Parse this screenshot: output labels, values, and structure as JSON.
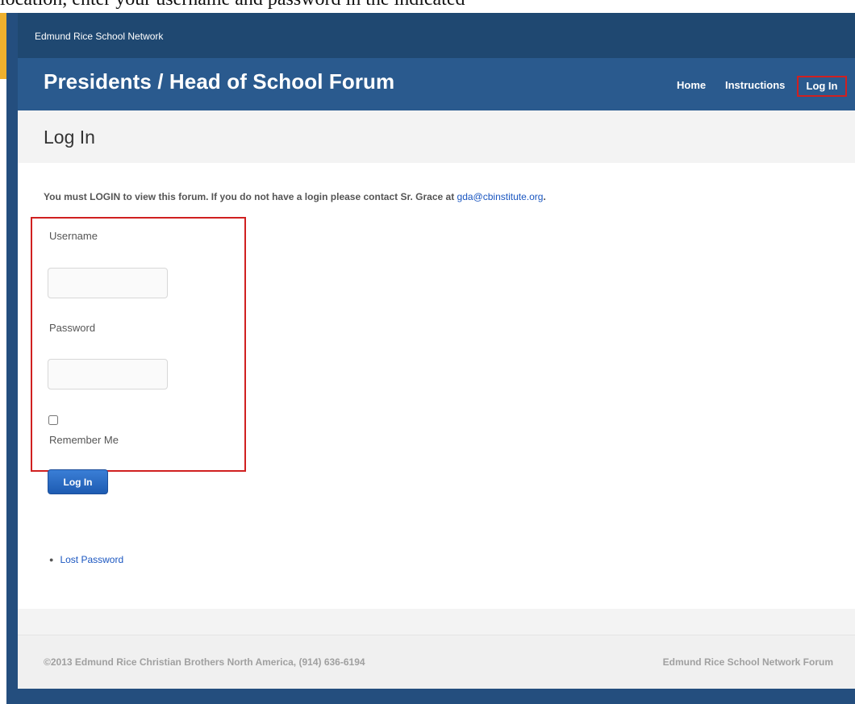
{
  "caption": "location, enter your username and password in the indicated",
  "network": {
    "label": "Edmund Rice School Network"
  },
  "header": {
    "title": "Presidents / Head of School Forum",
    "nav": {
      "home": "Home",
      "instructions": "Instructions",
      "login": "Log In"
    }
  },
  "page": {
    "title": "Log In"
  },
  "notice": {
    "text": "You must LOGIN to view this forum. If you do not have a login please contact Sr. Grace at ",
    "email": "gda@cbinstitute.org",
    "trailing": "."
  },
  "form": {
    "username_label": "Username",
    "username_value": "",
    "password_label": "Password",
    "password_value": "",
    "remember_label": "Remember Me",
    "remember_checked": false,
    "submit_label": "Log In"
  },
  "links": [
    {
      "label": "Lost Password"
    }
  ],
  "footer": {
    "copyright": "©2013 Edmund Rice Christian Brothers North America, (914) 636-6194",
    "site_name": "Edmund Rice School Network Forum"
  },
  "colors": {
    "header_blue": "#2a5a8e",
    "top_bar_navy": "#1f4871",
    "gold_accent": "#eeb02e",
    "highlight_red": "#d02020",
    "link_blue": "#1a56c0"
  }
}
